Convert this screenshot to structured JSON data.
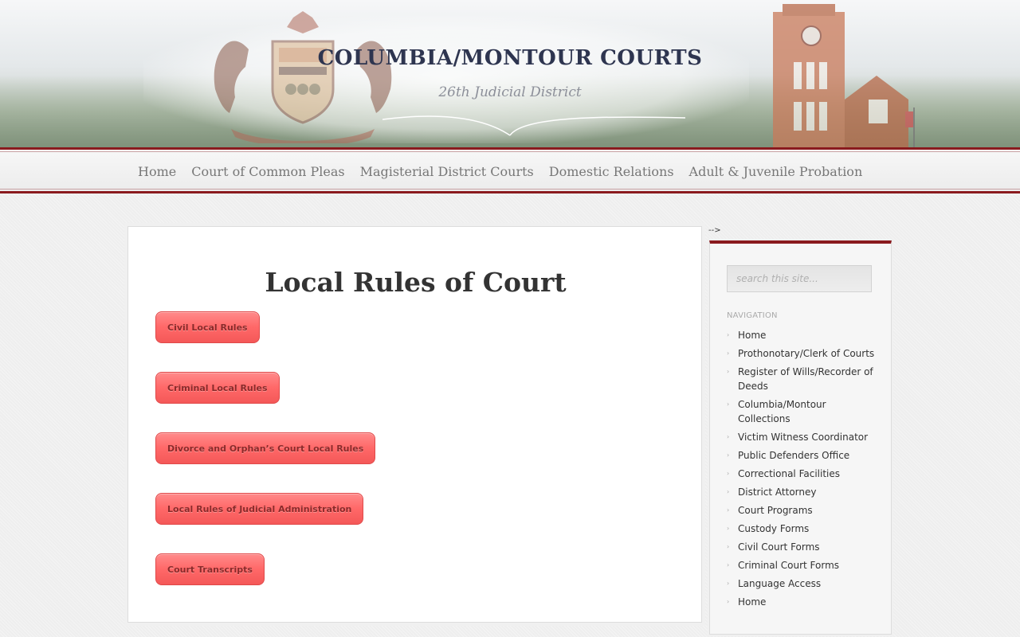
{
  "header": {
    "title": "COLUMBIA/MONTOUR COURTS",
    "subtitle": "26th Judicial District"
  },
  "nav": {
    "items": [
      {
        "label": "Home"
      },
      {
        "label": "Court of Common Pleas"
      },
      {
        "label": "Magisterial District Courts"
      },
      {
        "label": "Domestic Relations"
      },
      {
        "label": "Adult & Juvenile Probation"
      }
    ]
  },
  "main": {
    "title": "Local Rules of Court",
    "buttons": [
      {
        "label": "Civil Local Rules"
      },
      {
        "label": "Criminal Local Rules"
      },
      {
        "label": "Divorce and Orphan’s Court Local Rules"
      },
      {
        "label": "Local Rules of Judicial Administration"
      },
      {
        "label": "Court Transcripts"
      }
    ]
  },
  "stray_text": "-->",
  "sidebar": {
    "search_placeholder": "search this site...",
    "heading": "NAVIGATION",
    "items": [
      {
        "label": "Home"
      },
      {
        "label": "Prothonotary/Clerk of Courts"
      },
      {
        "label": "Register of Wills/Recorder of Deeds"
      },
      {
        "label": "Columbia/Montour Collections"
      },
      {
        "label": "Victim Witness Coordinator"
      },
      {
        "label": "Public Defenders Office"
      },
      {
        "label": "Correctional Facilities"
      },
      {
        "label": "District Attorney"
      },
      {
        "label": "Court Programs"
      },
      {
        "label": "Custody Forms"
      },
      {
        "label": "Civil Court Forms"
      },
      {
        "label": "Criminal Court Forms"
      },
      {
        "label": "Language Access"
      },
      {
        "label": "Home"
      }
    ]
  },
  "colors": {
    "accent": "#8a1a1e",
    "button": "#ff6b6b",
    "title": "#2e3550"
  },
  "icons": {
    "seal": "pennsylvania-coat-of-arms-icon",
    "tower": "courthouse-clock-tower-icon",
    "bullet": "bullet-icon"
  }
}
